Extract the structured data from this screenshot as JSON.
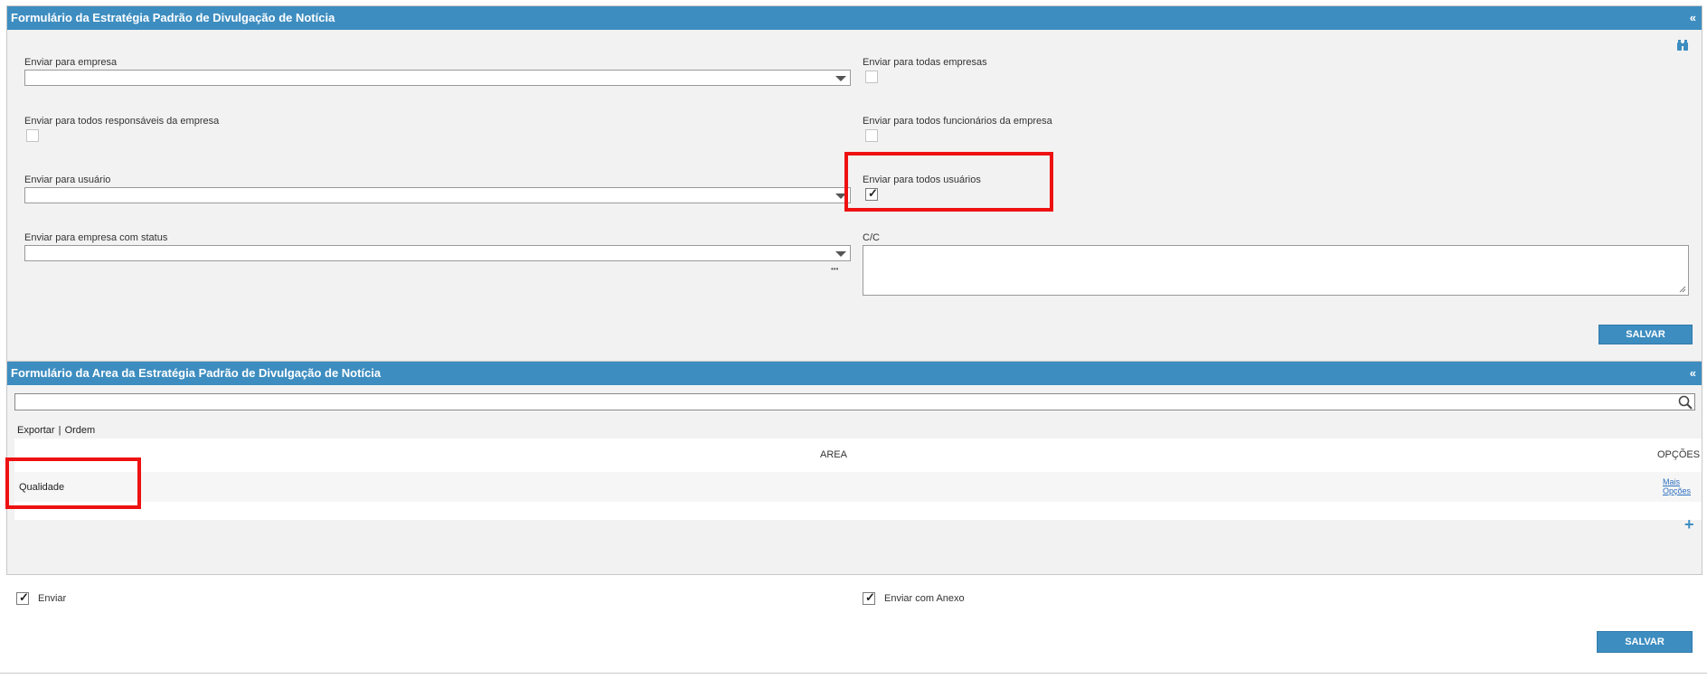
{
  "form1": {
    "title": "Formulário da Estratégia Padrão de Divulgação de Notícia",
    "collapse_icon": "«",
    "send_to_company_label": "Enviar para empresa",
    "send_to_all_companies_label": "Enviar para todas empresas",
    "send_to_all_company_managers_label": "Enviar para todos responsáveis da empresa",
    "send_to_all_company_employees_label": "Enviar para todos funcionários da empresa",
    "send_to_user_label": "Enviar para usuário",
    "send_to_all_users_label": "Enviar para todos usuários",
    "send_to_company_status_label": "Enviar para empresa com status",
    "cc_label": "C/C",
    "more_dots": "•••",
    "save_label": "SALVAR",
    "send_to_all_users_checked": true
  },
  "form2": {
    "title": "Formulário da Area da Estratégia Padrão de Divulgação de Notícia",
    "collapse_icon": "«",
    "export_label": "Exportar",
    "separator": "|",
    "order_label": "Ordem",
    "columns": [
      "AREA",
      "OPÇÕES"
    ],
    "rows": [
      {
        "area": "Qualidade",
        "options_line1": "Mais",
        "options_line2": "Opções"
      }
    ],
    "add_icon": "+"
  },
  "footer": {
    "send_label": "Enviar",
    "send_checked": true,
    "send_with_attachment_label": "Enviar com Anexo",
    "send_with_attachment_checked": true,
    "save_label": "SALVAR"
  },
  "icons": {
    "binoculars": "binoculars-icon",
    "search": "search-icon",
    "add": "plus-icon",
    "check": "✓"
  },
  "colors": {
    "header_bg": "#3d8dc0",
    "highlight": "#ee1111",
    "panel_bg": "#f2f2f2"
  }
}
